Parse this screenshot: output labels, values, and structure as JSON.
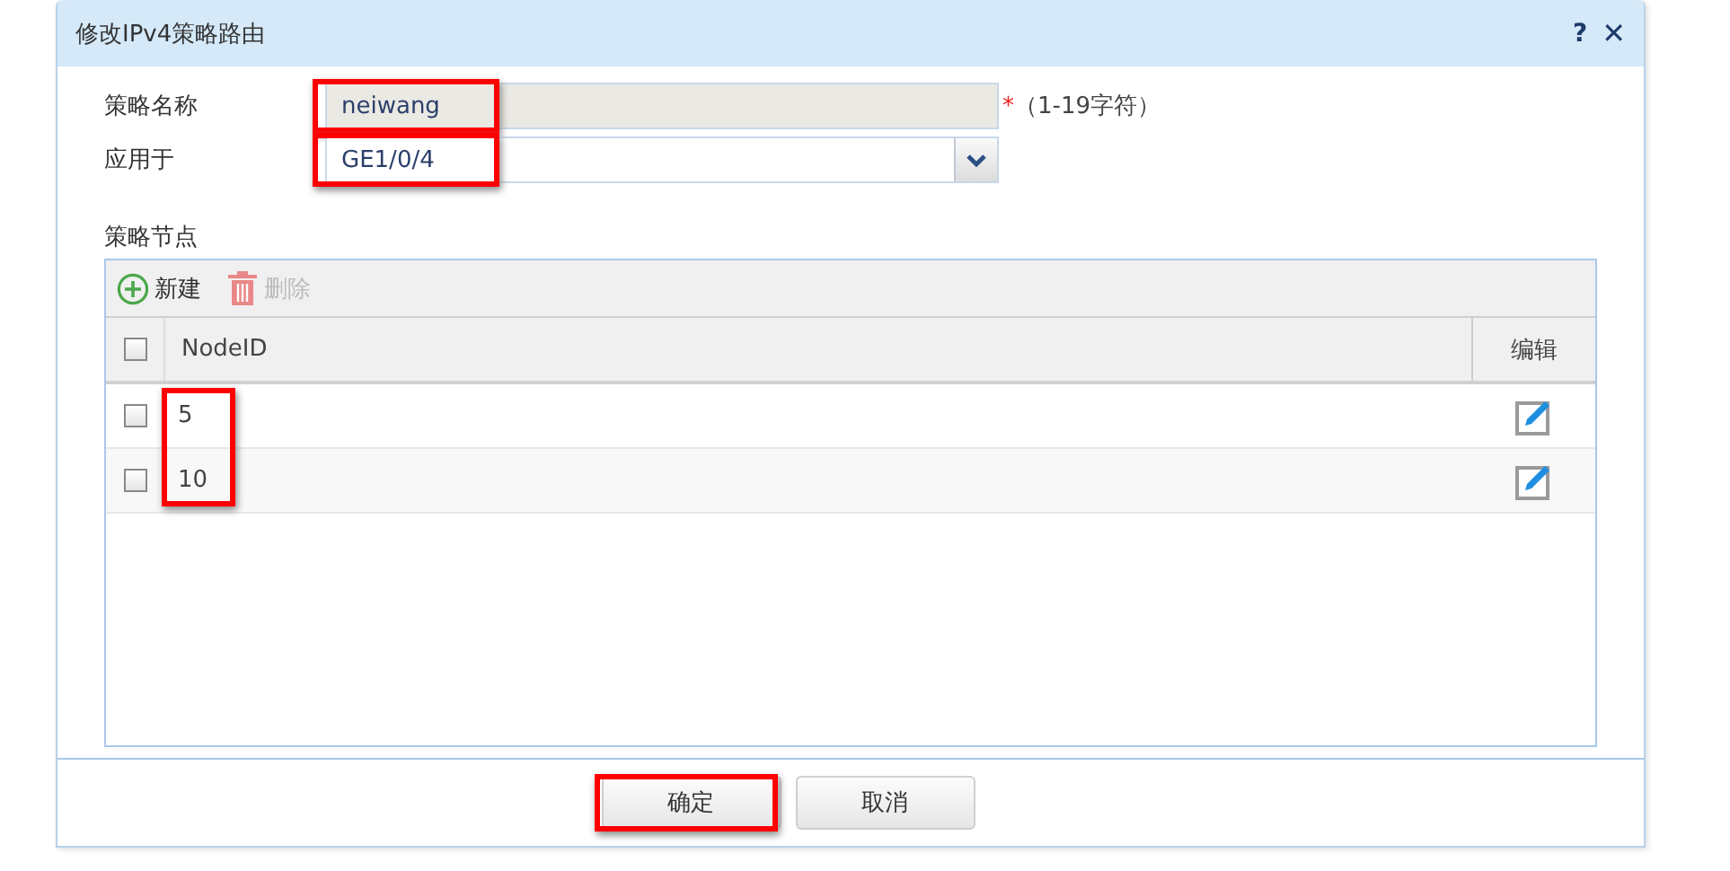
{
  "window": {
    "title": "修改IPv4策略路由",
    "help": "?",
    "close": "✕"
  },
  "form": {
    "name_label": "策略名称",
    "name_value": "neiwang",
    "name_highlighted": true,
    "required_mark": "*",
    "name_hint": "（1-19字符）",
    "apply_label": "应用于",
    "apply_value": "GE1/0/4",
    "apply_highlighted": true
  },
  "nodes": {
    "title": "策略节点",
    "toolbar": [
      {
        "kind": "add",
        "label": "新建",
        "disabled": false
      },
      {
        "kind": "delete",
        "label": "删除",
        "disabled": true
      }
    ],
    "select_all_checked": false,
    "columns": [
      "NodeID",
      "编辑"
    ],
    "id_column_highlighted": true,
    "rows": [
      {
        "checked": false,
        "node_id": "5"
      },
      {
        "checked": false,
        "node_id": "10"
      }
    ]
  },
  "buttons": [
    {
      "label": "确定",
      "highlighted": true
    },
    {
      "label": "取消",
      "highlighted": false
    }
  ]
}
